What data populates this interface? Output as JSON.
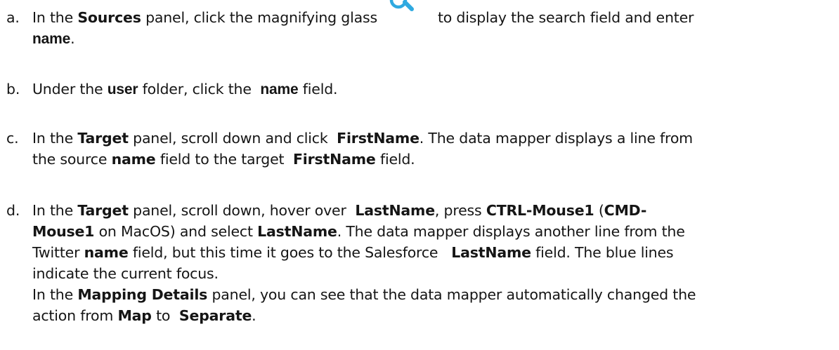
{
  "colors": {
    "text": "#151515",
    "icon": "#2fa9e0"
  },
  "icons": {
    "magnifier": "magnifying-glass-icon"
  },
  "steps": [
    {
      "marker": "a.",
      "parts": {
        "p1": "In the",
        "p2": "Sources",
        "p3": "panel, click the magnifying glass",
        "p4": "to display the search field and enter",
        "p5": "name",
        "p6": "."
      }
    },
    {
      "marker": "b.",
      "parts": {
        "p1": "Under the",
        "p2": "user",
        "p3": "folder, click the",
        "p4": "name",
        "p5": "field."
      }
    },
    {
      "marker": "c.",
      "parts": {
        "p1": "In the",
        "p2": "Target",
        "p3": "panel, scroll down and click",
        "p4": "FirstName",
        "p5": ". The data mapper displays a line from",
        "p6": "the source",
        "p7": "name",
        "p8": "field to the target",
        "p9": "FirstName",
        "p10": "field."
      }
    },
    {
      "marker": "d.",
      "parts": {
        "p1": "In the",
        "p2": "Target",
        "p3": "panel, scroll down, hover over",
        "p4": "LastName",
        "p5": ", press",
        "p6": "CTRL-Mouse1",
        "p7": "(",
        "p8": "CMD-",
        "p9": "Mouse1",
        "p10": "on MacOS) and select",
        "p11": "LastName",
        "p12": ". The data mapper displays another line from the",
        "p13": "Twitter",
        "p14": "name",
        "p15": "field, but this time it goes to the Salesforce",
        "p16": "LastName",
        "p17": "field. The blue lines",
        "p18": "indicate the current focus.",
        "p19": "In the",
        "p20": "Mapping Details",
        "p21": "panel, you can see that the data mapper automatically changed the",
        "p22": "action from",
        "p23": "Map",
        "p24": "to",
        "p25": "Separate",
        "p26": "."
      }
    }
  ]
}
